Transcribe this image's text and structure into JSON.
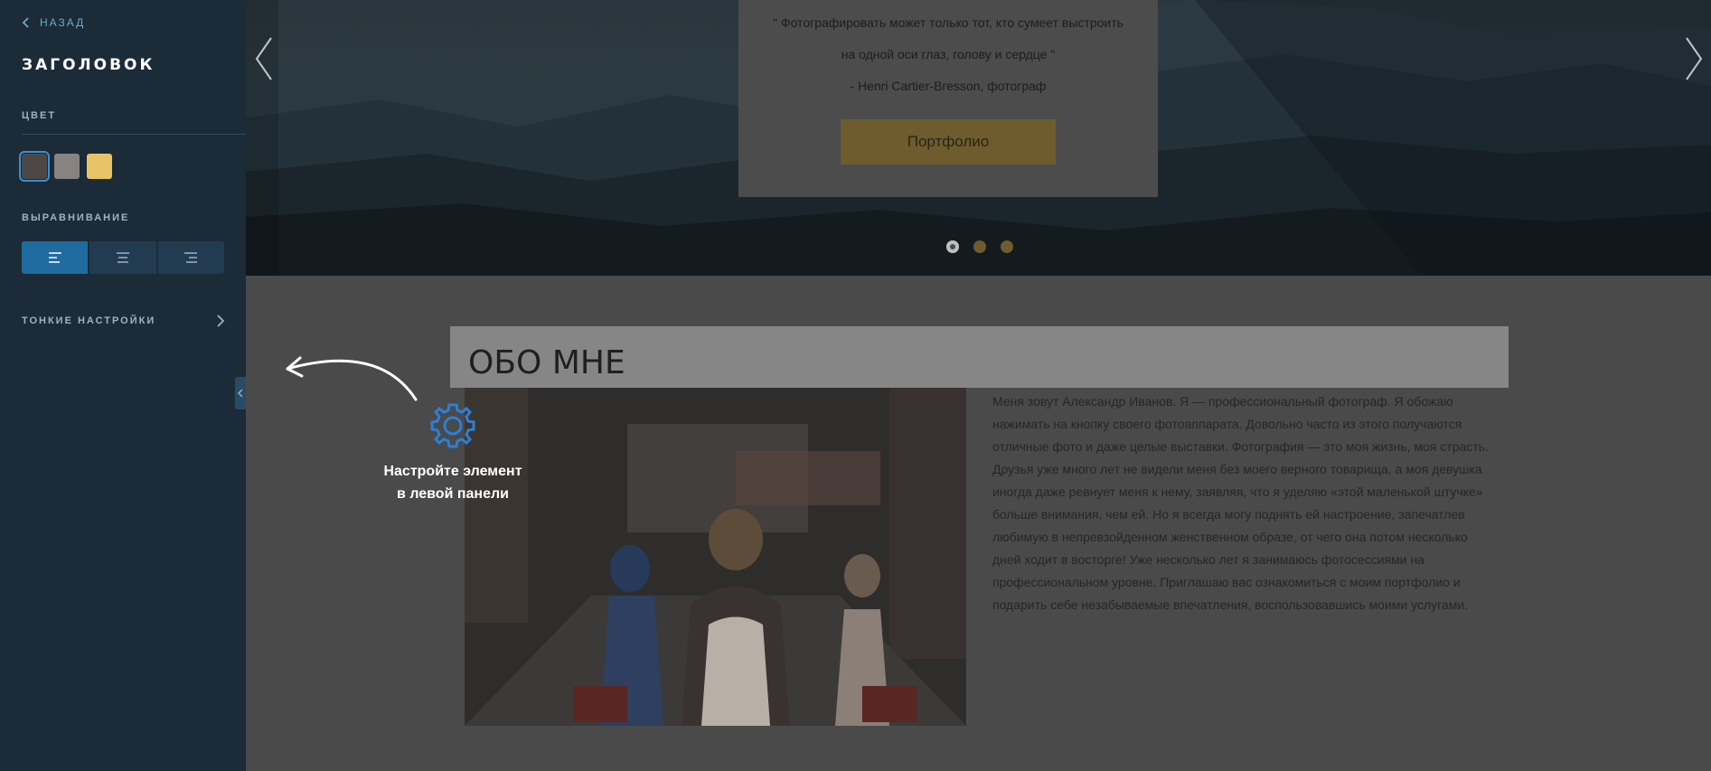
{
  "sidebar": {
    "back_label": "НАЗАД",
    "title": "ЗАГОЛОВОК",
    "color_label": "ЦВЕТ",
    "swatches": [
      "#4d4846",
      "#888380",
      "#e9c367"
    ],
    "selected_swatch": 0,
    "align_label": "ВЫРАВНИВАНИЕ",
    "align_options": [
      "align-left",
      "align-center",
      "align-right"
    ],
    "selected_align": "align-left",
    "fine_settings_label": "ТОНКИЕ НАСТРОЙКИ"
  },
  "hero": {
    "quote_line1": "\" Фотографировать может только тот, кто сумеет выстроить",
    "quote_line2": "на одной оси глаз, голову и сердце \"",
    "quote_author": "- Henri Cartier-Bresson, фотограф",
    "button_label": "Портфолио",
    "slider_dots": [
      "#bfbfbf",
      "#6e5c2e",
      "#6e5c2e"
    ],
    "active_dot": 0
  },
  "about": {
    "title": "ОБО МНЕ",
    "text": "Меня зовут Александр Иванов. Я — профессиональный фотограф. Я обожаю нажимать на кнопку своего фотоаппарата. Довольно часто из этого получаются отличные фото и даже целые выставки. Фотография — это моя жизнь, моя страсть. Друзья уже много лет не видели меня без моего верного товарища, а моя девушка иногда даже ревнует меня к нему, заявляя, что я уделяю «этой маленькой штучке» больше внимания, чем ей. Но я всегда могу поднять ей настроение, запечатлев любимую в непревзойденном женственном образе, от чего она потом несколько дней ходит в восторге! Уже несколько лет я занимаюсь фотосессиями на профессиональном уровне. Приглашаю вас ознакомиться с моим портфолио и подарить себе незабываемые впечатления, воспользовавшись моими услугами."
  },
  "hint": {
    "line1": "Настройте элемент",
    "line2": "в левой панели"
  },
  "icons": {
    "back": "chevron-left-icon",
    "fine_settings": "chevron-right-icon",
    "collapse": "chevron-left-icon",
    "hint": "gear-icon",
    "arrow": "curved-arrow-icon"
  },
  "colors": {
    "sidebar_bg": "#1b2b38",
    "accent": "#3a8fd6",
    "selected_align_bg": "#1f6b9f"
  }
}
